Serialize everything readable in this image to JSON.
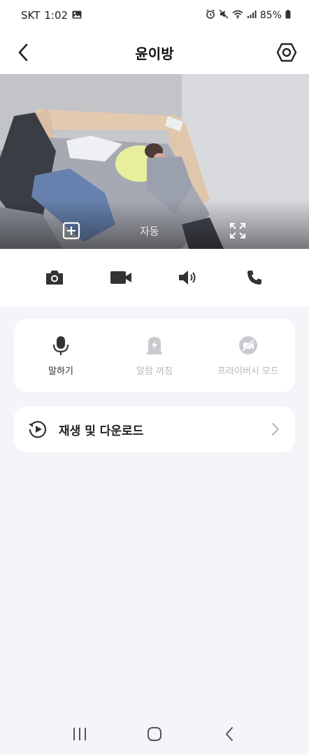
{
  "status_bar": {
    "carrier": "SKT",
    "time": "1:02",
    "battery": "85%",
    "icons": [
      "gallery-icon",
      "alarm-icon",
      "mute-icon",
      "wifi-icon",
      "signal-icon",
      "battery-icon"
    ]
  },
  "header": {
    "title": "윤이방",
    "back_icon": "chevron-left-icon",
    "settings_icon": "settings-icon"
  },
  "video": {
    "add_icon": "add-square-icon",
    "mode_label": "자동",
    "fullscreen_icon": "fullscreen-icon"
  },
  "toolbar": {
    "items": [
      "camera-icon",
      "video-record-icon",
      "speaker-icon",
      "phone-icon"
    ]
  },
  "actions": [
    {
      "label": "말하기",
      "icon": "microphone-icon",
      "enabled": true
    },
    {
      "label": "알람 꺼짐",
      "icon": "alarm-off-icon",
      "enabled": false
    },
    {
      "label": "프라이버시 모드",
      "icon": "privacy-mode-icon",
      "enabled": false
    }
  ],
  "playback": {
    "label": "재생 및 다운로드",
    "icon": "playback-icon"
  },
  "colors": {
    "background": "#f4f5f9",
    "card": "#ffffff",
    "text": "#222222",
    "muted": "#b5b7bd"
  }
}
